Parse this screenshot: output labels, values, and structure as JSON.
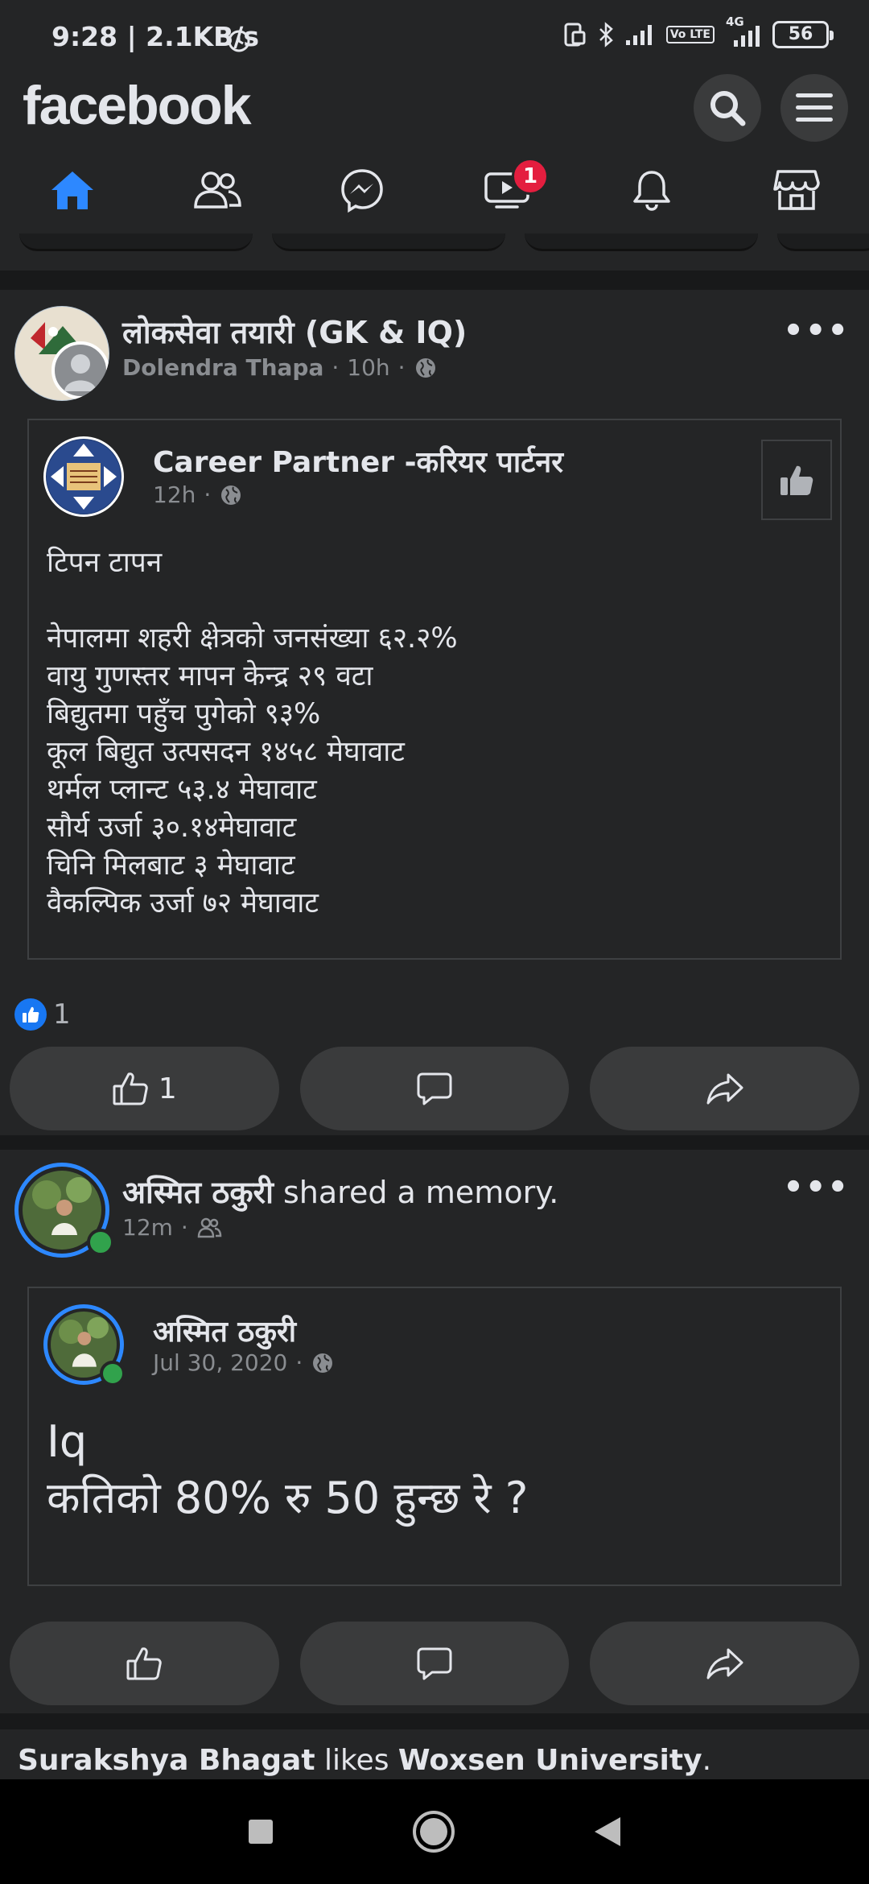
{
  "status_bar": {
    "time_speed": "9:28 | 2.1KB/s",
    "volte": "Vo LTE",
    "network": "4G",
    "battery": "56"
  },
  "header": {
    "logo": "facebook"
  },
  "nav": {
    "tabs": [
      "home",
      "friends",
      "messenger",
      "watch",
      "notifications",
      "marketplace"
    ],
    "watch_badge": "1",
    "active_color": "#2d88ff"
  },
  "post1": {
    "group": "लोकसेवा तयारी (GK & IQ)",
    "author": "Dolendra Thapa",
    "time": "10h",
    "shared": {
      "page": "Career Partner -करियर पार्टनर",
      "time": "12h",
      "text": "टिपन टापन\n\nनेपालमा शहरी क्षेत्रको जनसंख्या ६२.२%\nवायु गुणस्तर मापन केन्द्र २९ वटा\nबिद्युतमा पहुँच पुगेको ९३%\nकूल बिद्युत उत्पसदन १४५८ मेघावाट\nथर्मल प्लान्ट ५३.४ मेघावाट\nसौर्य उर्जा ३०.१४मेघावाट\nचिनि मिलबाट ३ मेघावाट\nवैकल्पिक उर्जा ७२ मेघावाट"
    },
    "reaction_count": "1",
    "like_count": "1"
  },
  "post2": {
    "author": "अस्मित ठकुरी",
    "action": " shared a memory.",
    "time": "12m",
    "shared": {
      "author": "अस्मित ठकुरी",
      "date": "Jul 30, 2020",
      "text": "Iq\nकतिको 80% रु 50 हुन्छ रे ?"
    }
  },
  "next_story": {
    "person": "Surakshya Bhagat",
    "verb": " likes ",
    "page": "Woxsen University",
    "end": "."
  }
}
